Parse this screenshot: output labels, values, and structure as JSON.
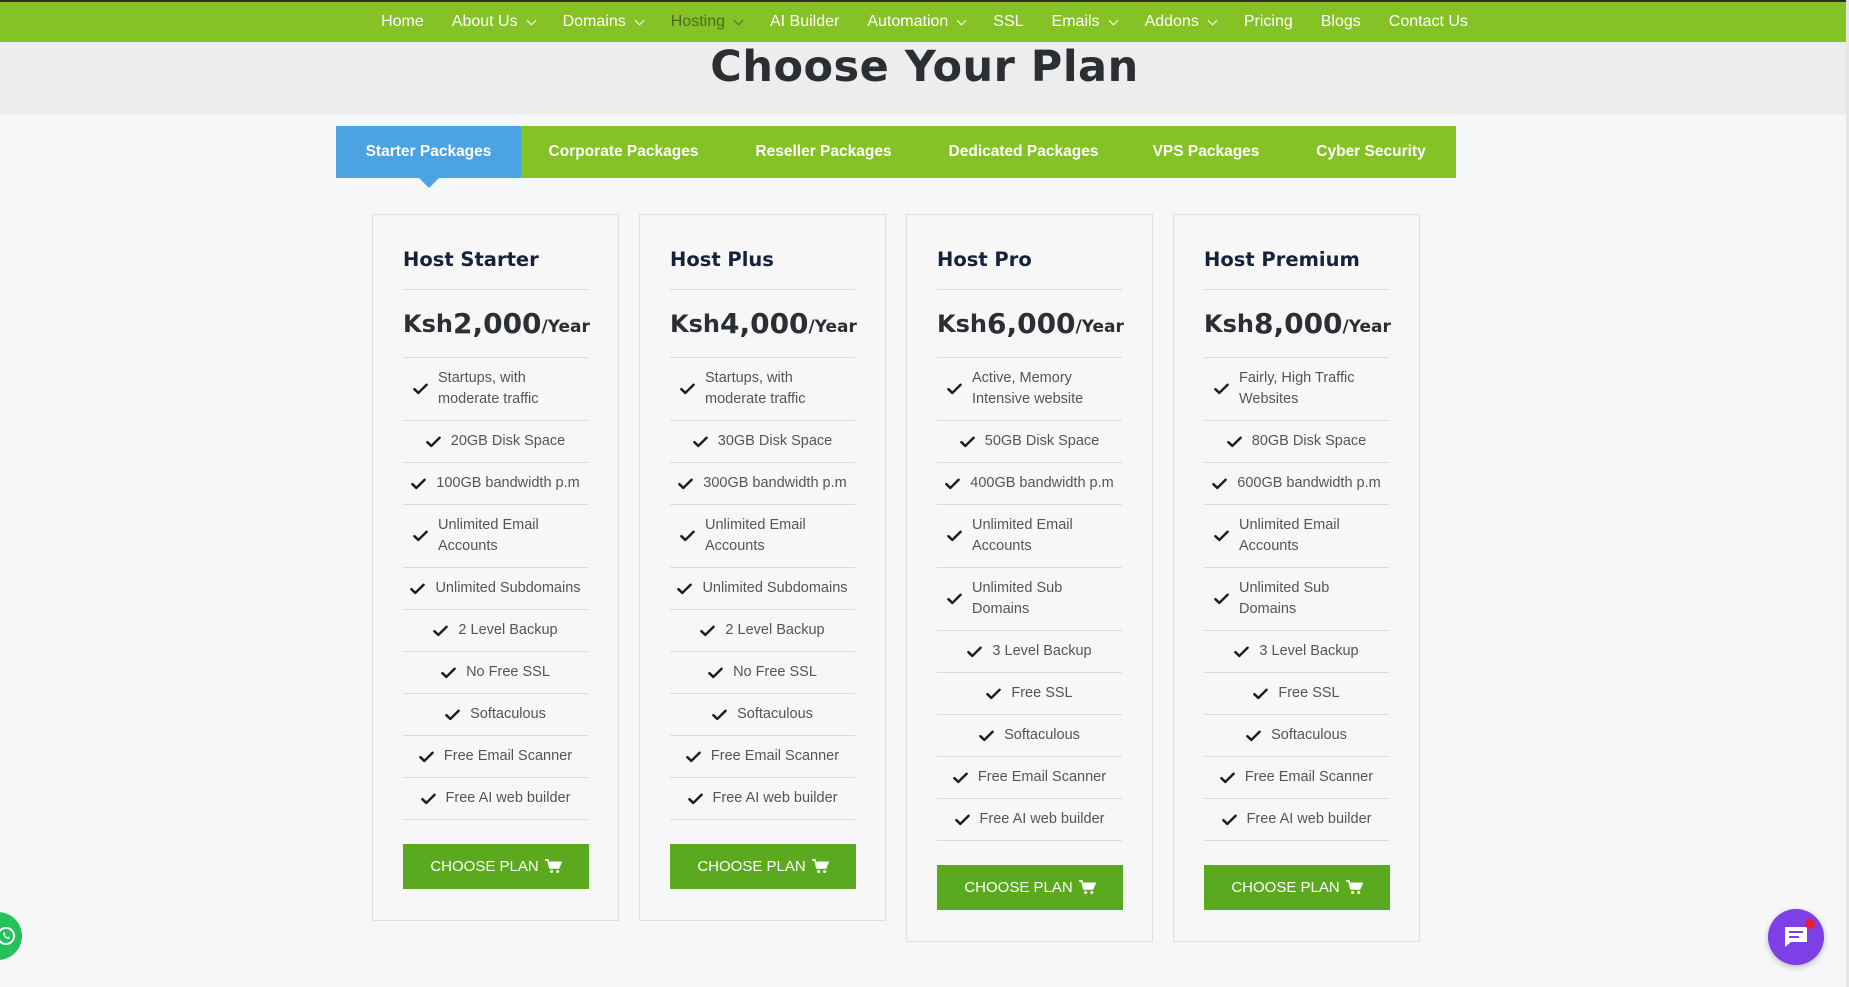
{
  "nav": {
    "items": [
      {
        "label": "Home",
        "dropdown": false,
        "dim": false
      },
      {
        "label": "About Us",
        "dropdown": true,
        "dim": false
      },
      {
        "label": "Domains",
        "dropdown": true,
        "dim": false
      },
      {
        "label": "Hosting",
        "dropdown": true,
        "dim": true
      },
      {
        "label": "AI Builder",
        "dropdown": false,
        "dim": false
      },
      {
        "label": "Automation",
        "dropdown": true,
        "dim": false
      },
      {
        "label": "SSL",
        "dropdown": false,
        "dim": false
      },
      {
        "label": "Emails",
        "dropdown": true,
        "dim": false
      },
      {
        "label": "Addons",
        "dropdown": true,
        "dim": false
      },
      {
        "label": "Pricing",
        "dropdown": false,
        "dim": false
      },
      {
        "label": "Blogs",
        "dropdown": false,
        "dim": false
      },
      {
        "label": "Contact Us",
        "dropdown": false,
        "dim": false
      }
    ]
  },
  "page": {
    "title": "Choose Your Plan"
  },
  "tabs": [
    {
      "label": "Starter Packages",
      "active": true
    },
    {
      "label": "Corporate Packages",
      "active": false
    },
    {
      "label": "Reseller Packages",
      "active": false
    },
    {
      "label": "Dedicated Packages",
      "active": false
    },
    {
      "label": "VPS Packages",
      "active": false
    },
    {
      "label": "Cyber Security",
      "active": false
    }
  ],
  "plans": [
    {
      "name": "Host Starter",
      "currency": "Ksh ",
      "amount": "2,000",
      "period": "/Year",
      "features": [
        "Startups, with moderate traffic",
        "20GB Disk Space",
        "100GB bandwidth p.m",
        "Unlimited Email Accounts",
        "Unlimited Subdomains",
        "2 Level Backup",
        "No Free SSL",
        "Softaculous",
        "Free Email Scanner",
        "Free AI web builder"
      ],
      "button": "CHOOSE PLAN"
    },
    {
      "name": "Host Plus",
      "currency": "Ksh ",
      "amount": "4,000",
      "period": "/Year",
      "features": [
        "Startups, with moderate traffic",
        "30GB Disk Space",
        "300GB bandwidth p.m",
        "Unlimited Email Accounts",
        "Unlimited Subdomains",
        "2 Level Backup",
        "No Free SSL",
        "Softaculous",
        "Free Email Scanner",
        "Free AI web builder"
      ],
      "button": "CHOOSE PLAN"
    },
    {
      "name": "Host Pro",
      "currency": "Ksh",
      "amount": "6,000",
      "period": "/Year",
      "features": [
        "Active, Memory Intensive website",
        "50GB Disk Space",
        "400GB bandwidth p.m",
        "Unlimited Email Accounts",
        "Unlimited Sub Domains",
        "3 Level Backup",
        "Free SSL",
        "Softaculous",
        "Free Email Scanner",
        "Free AI web builder"
      ],
      "button": "CHOOSE PLAN"
    },
    {
      "name": "Host Premium",
      "currency": "Ksh",
      "amount": "8,000",
      "period": "/Year",
      "features": [
        "Fairly, High Traffic Websites",
        "80GB Disk Space",
        "600GB bandwidth p.m",
        "Unlimited Email Accounts",
        "Unlimited Sub Domains",
        "3 Level Backup",
        "Free SSL",
        "Softaculous",
        "Free Email Scanner",
        "Free AI web builder"
      ],
      "button": "CHOOSE PLAN"
    }
  ],
  "colors": {
    "brand_green": "#84c225",
    "button_green": "#5aa91f",
    "active_tab_blue": "#4ba3e2",
    "chat_purple": "#7e3fe6",
    "whatsapp_green": "#25c159"
  },
  "icons": {
    "nav_dropdown": "chevron-down-icon",
    "feature": "check-icon",
    "button": "cart-icon",
    "floating_left": "whatsapp-icon",
    "floating_right": "chat-icon"
  }
}
